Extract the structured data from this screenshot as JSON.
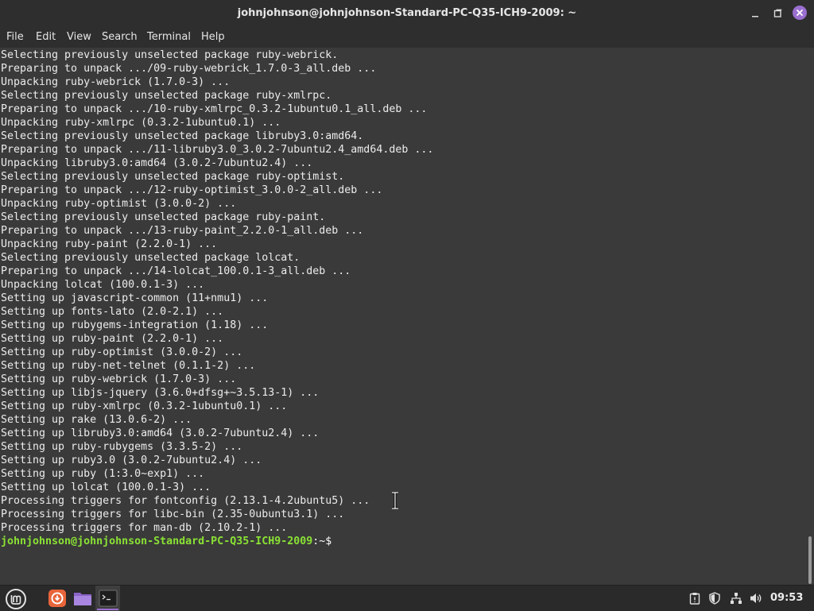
{
  "window": {
    "title": "johnjohnson@johnjohnson-Standard-PC-Q35-ICH9-2009: ~"
  },
  "menu": [
    {
      "label": "File"
    },
    {
      "label": "Edit"
    },
    {
      "label": "View"
    },
    {
      "label": "Search"
    },
    {
      "label": "Terminal"
    },
    {
      "label": "Help"
    }
  ],
  "terminal": {
    "lines": [
      "Selecting previously unselected package ruby-webrick.",
      "Preparing to unpack .../09-ruby-webrick_1.7.0-3_all.deb ...",
      "Unpacking ruby-webrick (1.7.0-3) ...",
      "Selecting previously unselected package ruby-xmlrpc.",
      "Preparing to unpack .../10-ruby-xmlrpc_0.3.2-1ubuntu0.1_all.deb ...",
      "Unpacking ruby-xmlrpc (0.3.2-1ubuntu0.1) ...",
      "Selecting previously unselected package libruby3.0:amd64.",
      "Preparing to unpack .../11-libruby3.0_3.0.2-7ubuntu2.4_amd64.deb ...",
      "Unpacking libruby3.0:amd64 (3.0.2-7ubuntu2.4) ...",
      "Selecting previously unselected package ruby-optimist.",
      "Preparing to unpack .../12-ruby-optimist_3.0.0-2_all.deb ...",
      "Unpacking ruby-optimist (3.0.0-2) ...",
      "Selecting previously unselected package ruby-paint.",
      "Preparing to unpack .../13-ruby-paint_2.2.0-1_all.deb ...",
      "Unpacking ruby-paint (2.2.0-1) ...",
      "Selecting previously unselected package lolcat.",
      "Preparing to unpack .../14-lolcat_100.0.1-3_all.deb ...",
      "Unpacking lolcat (100.0.1-3) ...",
      "Setting up javascript-common (11+nmu1) ...",
      "Setting up fonts-lato (2.0-2.1) ...",
      "Setting up rubygems-integration (1.18) ...",
      "Setting up ruby-paint (2.2.0-1) ...",
      "Setting up ruby-optimist (3.0.0-2) ...",
      "Setting up ruby-net-telnet (0.1.1-2) ...",
      "Setting up ruby-webrick (1.7.0-3) ...",
      "Setting up libjs-jquery (3.6.0+dfsg+~3.5.13-1) ...",
      "Setting up ruby-xmlrpc (0.3.2-1ubuntu0.1) ...",
      "Setting up rake (13.0.6-2) ...",
      "Setting up libruby3.0:amd64 (3.0.2-7ubuntu2.4) ...",
      "Setting up ruby-rubygems (3.3.5-2) ...",
      "Setting up ruby3.0 (3.0.2-7ubuntu2.4) ...",
      "Setting up ruby (1:3.0~exp1) ...",
      "Setting up lolcat (100.0.1-3) ...",
      "Processing triggers for fontconfig (2.13.1-4.2ubuntu5) ...",
      "Processing triggers for libc-bin (2.35-0ubuntu3.1) ...",
      "Processing triggers for man-db (2.10.2-1) ..."
    ],
    "prompt_user": "johnjohnson@johnjohnson-Standard-PC-Q35-ICH9-2009",
    "prompt_path": ":~$"
  },
  "taskbar": {
    "clock": "09:53",
    "accent_color": "#9b6fd0"
  }
}
